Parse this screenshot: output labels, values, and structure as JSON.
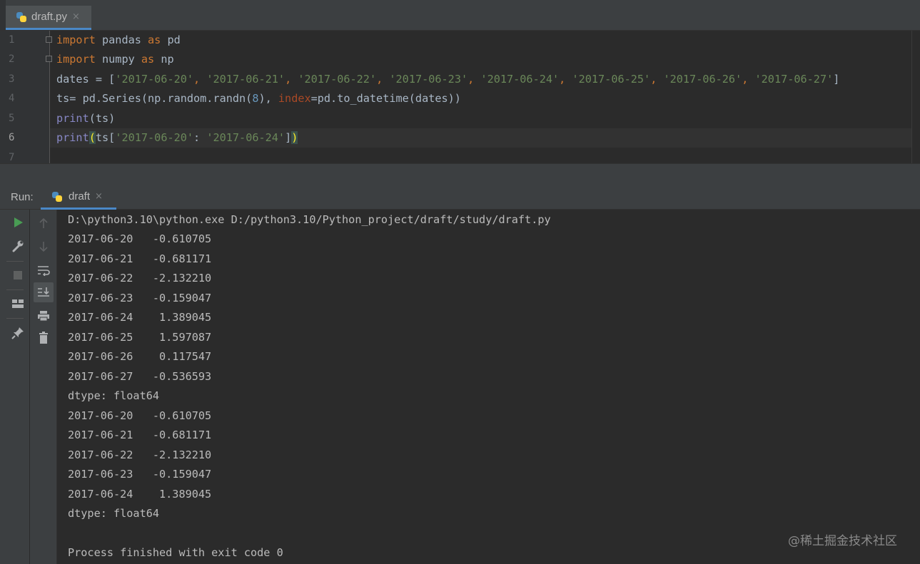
{
  "editor": {
    "tab": {
      "file_name": "draft.py",
      "close_glyph": "×",
      "icon": "python-file-icon"
    },
    "line_numbers": [
      "1",
      "2",
      "3",
      "4",
      "5",
      "6",
      "7"
    ],
    "lines": [
      [
        {
          "t": "import",
          "c": "kw"
        },
        {
          "t": " pandas ",
          "c": ""
        },
        {
          "t": "as",
          "c": "kw"
        },
        {
          "t": " pd",
          "c": ""
        }
      ],
      [
        {
          "t": "import",
          "c": "kw"
        },
        {
          "t": " numpy ",
          "c": ""
        },
        {
          "t": "as",
          "c": "kw"
        },
        {
          "t": " np",
          "c": ""
        }
      ],
      [
        {
          "t": "dates = [",
          "c": ""
        },
        {
          "t": "'2017-06-20'",
          "c": "str"
        },
        {
          "t": ", ",
          "c": "kw"
        },
        {
          "t": "'2017-06-21'",
          "c": "str"
        },
        {
          "t": ", ",
          "c": "kw"
        },
        {
          "t": "'2017-06-22'",
          "c": "str"
        },
        {
          "t": ", ",
          "c": "kw"
        },
        {
          "t": "'2017-06-23'",
          "c": "str"
        },
        {
          "t": ", ",
          "c": "kw"
        },
        {
          "t": "'2017-06-24'",
          "c": "str"
        },
        {
          "t": ", ",
          "c": "kw"
        },
        {
          "t": "'2017-06-25'",
          "c": "str"
        },
        {
          "t": ", ",
          "c": "kw"
        },
        {
          "t": "'2017-06-26'",
          "c": "str"
        },
        {
          "t": ", ",
          "c": "kw"
        },
        {
          "t": "'2017-06-27'",
          "c": "str"
        },
        {
          "t": "]",
          "c": ""
        }
      ],
      [
        {
          "t": "ts= pd.Series(np.random.randn(",
          "c": ""
        },
        {
          "t": "8",
          "c": "num"
        },
        {
          "t": "), ",
          "c": ""
        },
        {
          "t": "index",
          "c": "par"
        },
        {
          "t": "=pd.to_datetime(dates))",
          "c": ""
        }
      ],
      [
        {
          "t": "print",
          "c": "bi"
        },
        {
          "t": "(ts)",
          "c": ""
        }
      ],
      [
        {
          "t": "print",
          "c": "bi"
        },
        {
          "t": "(",
          "c": "brace-match"
        },
        {
          "t": "ts[",
          "c": ""
        },
        {
          "t": "'2017-06-20'",
          "c": "str"
        },
        {
          "t": ": ",
          "c": ""
        },
        {
          "t": "'2017-06-24'",
          "c": "str"
        },
        {
          "t": "]",
          "c": ""
        },
        {
          "t": ")",
          "c": "brace-match"
        }
      ],
      []
    ]
  },
  "run_panel": {
    "title": "Run:",
    "tab_label": "draft",
    "close_glyph": "×",
    "output_lines": [
      "D:\\python3.10\\python.exe D:/python3.10/Python_project/draft/study/draft.py",
      "2017-06-20   -0.610705",
      "2017-06-21   -0.681171",
      "2017-06-22   -2.132210",
      "2017-06-23   -0.159047",
      "2017-06-24    1.389045",
      "2017-06-25    1.597087",
      "2017-06-26    0.117547",
      "2017-06-27   -0.536593",
      "dtype: float64",
      "2017-06-20   -0.610705",
      "2017-06-21   -0.681171",
      "2017-06-22   -2.132210",
      "2017-06-23   -0.159047",
      "2017-06-24    1.389045",
      "dtype: float64",
      "",
      "Process finished with exit code 0"
    ]
  },
  "toolbar_left": [
    "run-icon",
    "wrench-icon",
    "stop-icon",
    "layout-icon",
    "pin-icon"
  ],
  "toolbar_right": [
    "arrow-up-icon",
    "arrow-down-icon",
    "soft-wrap-icon",
    "scroll-to-end-icon",
    "print-icon",
    "trash-icon"
  ],
  "colors": {
    "keyword": "#cc7832",
    "string": "#6a8759",
    "number": "#6897bb",
    "param": "#aa4926",
    "builtin": "#8888c6",
    "text": "#a9b7c6",
    "run_green": "#499c54",
    "tab_accent": "#4a88c7"
  },
  "watermark": "@稀土掘金技术社区"
}
